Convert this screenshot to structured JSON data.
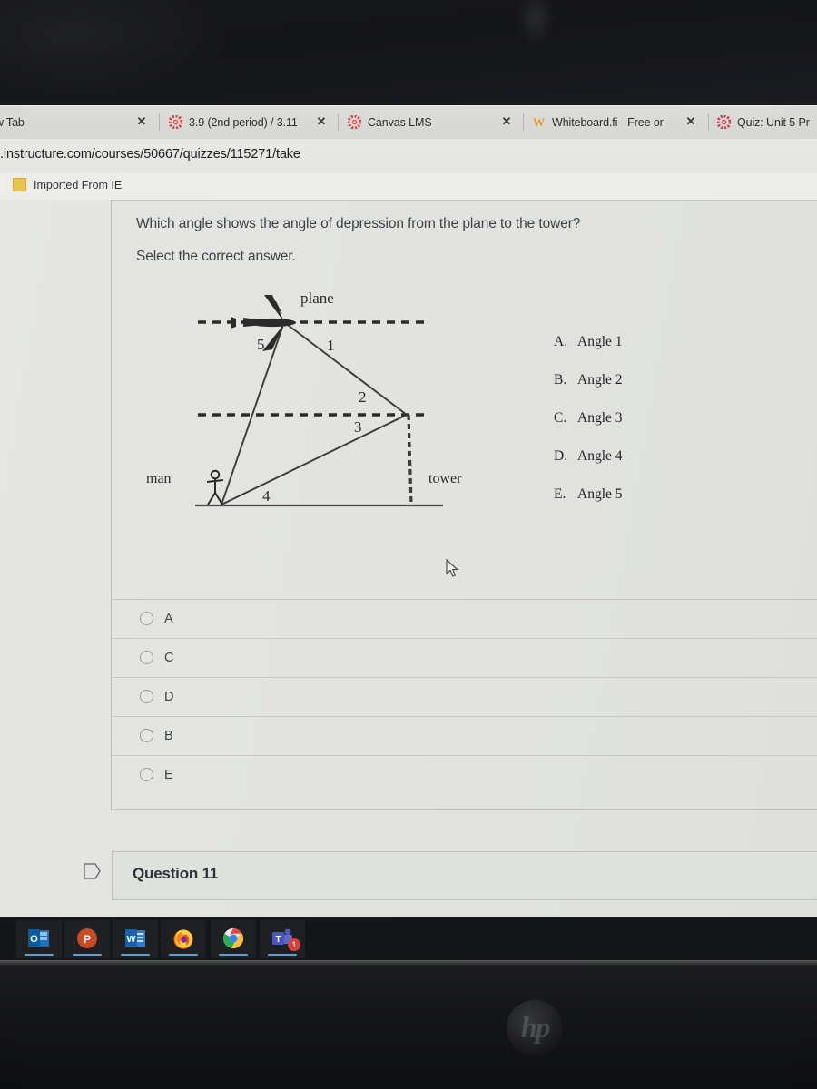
{
  "browser": {
    "tabs": [
      {
        "title": "ew Tab",
        "favicon": "none",
        "close_label": "✕"
      },
      {
        "title": "3.9 (2nd period) / 3.11",
        "favicon": "canvas-icon",
        "close_label": "✕"
      },
      {
        "title": "Canvas LMS",
        "favicon": "canvas-icon",
        "close_label": "✕"
      },
      {
        "title": "Whiteboard.fi - Free or",
        "favicon": "whiteboard-icon",
        "close_label": "✕"
      },
      {
        "title": "Quiz: Unit 5 Pr",
        "favicon": "canvas-icon",
        "close_label": ""
      }
    ],
    "url": ".instructure.com/courses/50667/quizzes/115271/take",
    "bookmarks": [
      {
        "label": "Imported From IE",
        "icon": "folder-icon"
      }
    ]
  },
  "quiz": {
    "prompt": "Which angle shows the angle of depression from the plane to the tower?",
    "instruction": "Select the correct answer.",
    "figure": {
      "labels": {
        "plane": "plane",
        "man": "man",
        "tower": "tower",
        "angle1": "1",
        "angle2": "2",
        "angle3": "3",
        "angle4": "4",
        "angle5": "5"
      }
    },
    "image_choices": [
      {
        "letter": "A.",
        "text": "Angle 1"
      },
      {
        "letter": "B.",
        "text": "Angle 2"
      },
      {
        "letter": "C.",
        "text": "Angle 3"
      },
      {
        "letter": "D.",
        "text": "Angle 4"
      },
      {
        "letter": "E.",
        "text": "Angle 5"
      }
    ],
    "answers": [
      {
        "label": "A",
        "selected": false
      },
      {
        "label": "C",
        "selected": false
      },
      {
        "label": "D",
        "selected": false
      },
      {
        "label": "B",
        "selected": false
      },
      {
        "label": "E",
        "selected": false
      }
    ],
    "next_question_header": "Question 11"
  },
  "taskbar": {
    "items": [
      {
        "name": "outlook-icon",
        "badge": ""
      },
      {
        "name": "powerpoint-icon",
        "badge": ""
      },
      {
        "name": "word-icon",
        "badge": ""
      },
      {
        "name": "firefox-icon",
        "badge": ""
      },
      {
        "name": "chrome-icon",
        "badge": ""
      },
      {
        "name": "teams-icon",
        "badge": "1"
      }
    ]
  },
  "device": {
    "brand_logo": "hp"
  },
  "colors": {
    "page_bg": "#e2e3df",
    "chrome_bg": "#dcdcd9",
    "text": "#3b4347",
    "canvas_red": "#e03e3e",
    "taskbar_bg": "#14161a",
    "accent_blue": "#5aa0d8"
  }
}
